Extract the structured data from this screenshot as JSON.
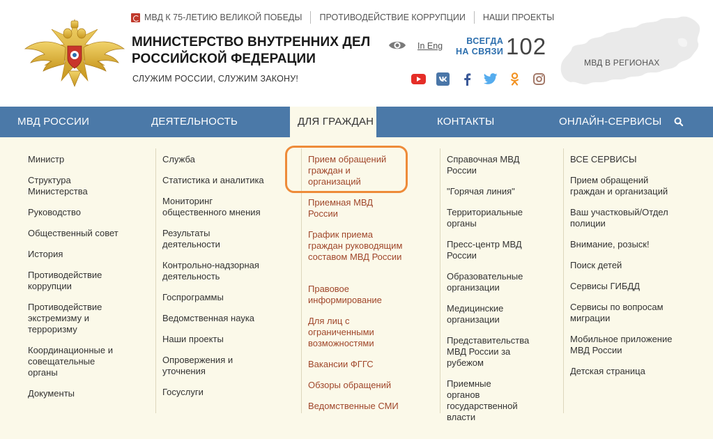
{
  "header": {
    "top_links": [
      "МВД К 75-ЛЕТИЮ ВЕЛИКОЙ ПОБЕДЫ",
      "ПРОТИВОДЕЙСТВИЕ КОРРУПЦИИ",
      "НАШИ ПРОЕКТЫ"
    ],
    "title_line1": "МИНИСТЕРСТВО ВНУТРЕННИХ ДЕЛ",
    "title_line2": "РОССИЙСКОЙ ФЕДЕРАЦИИ",
    "motto": "СЛУЖИМ РОССИИ, СЛУЖИМ ЗАКОНУ!",
    "lang_link": "In Eng",
    "always_line1": "ВСЕГДА",
    "always_line2": "НА СВЯЗИ",
    "hotline": "102",
    "regions_label": "МВД В РЕГИОНАХ",
    "socials": [
      "youtube-icon",
      "vk-icon",
      "facebook-icon",
      "twitter-icon",
      "odnoklassniki-icon",
      "instagram-icon"
    ]
  },
  "nav": {
    "items": [
      "МВД РОССИИ",
      "ДЕЯТЕЛЬНОСТЬ",
      "ДЛЯ ГРАЖДАН",
      "КОНТАКТЫ",
      "ОНЛАЙН-СЕРВИСЫ"
    ],
    "active": "ДЛЯ ГРАЖДАН"
  },
  "menu": {
    "col1": [
      "Министр",
      "Структура Министерства",
      "Руководство",
      "Общественный совет",
      "История",
      "Противодействие коррупции",
      "Противодействие экстремизму и терроризму",
      "Координационные и совещательные органы",
      "Документы"
    ],
    "col2": [
      "Служба",
      "Статистика и аналитика",
      "Мониторинг общественного мнения",
      "Результаты деятельности",
      "Контрольно-надзорная деятельность",
      "Госпрограммы",
      "Ведомственная наука",
      "Наши проекты",
      "Опровержения и уточнения",
      "Госуслуги"
    ],
    "col3": [
      "Прием обращений граждан и организаций",
      "Приемная МВД России",
      "График приема граждан руководящим составом МВД России",
      "Правовое информирование",
      "Для лиц с ограниченными возможностями",
      "Вакансии ФГГС",
      "Обзоры обращений",
      "Ведомственные СМИ"
    ],
    "col4": [
      "Справочная МВД России",
      "\"Горячая линия\"",
      "Территориальные органы",
      "Пресс-центр МВД России",
      "Образовательные организации",
      "Медицинские организации",
      "Представительства МВД России за рубежом",
      "Приемные органов государственной власти"
    ],
    "col5": [
      "ВСЕ СЕРВИСЫ",
      "Прием обращений граждан и организаций",
      "Ваш участковый/Отдел полиции",
      "Внимание, розыск!",
      "Поиск детей",
      "Сервисы ГИБДД",
      "Сервисы по вопросам миграции",
      "Мобильное приложение МВД России",
      "Детская страница"
    ]
  },
  "colors": {
    "nav_bg": "#4b79a8",
    "panel_bg": "#fbf9e9",
    "accent_link": "#a0472b",
    "highlight": "#ee8b39",
    "always_text": "#2d6fae"
  }
}
